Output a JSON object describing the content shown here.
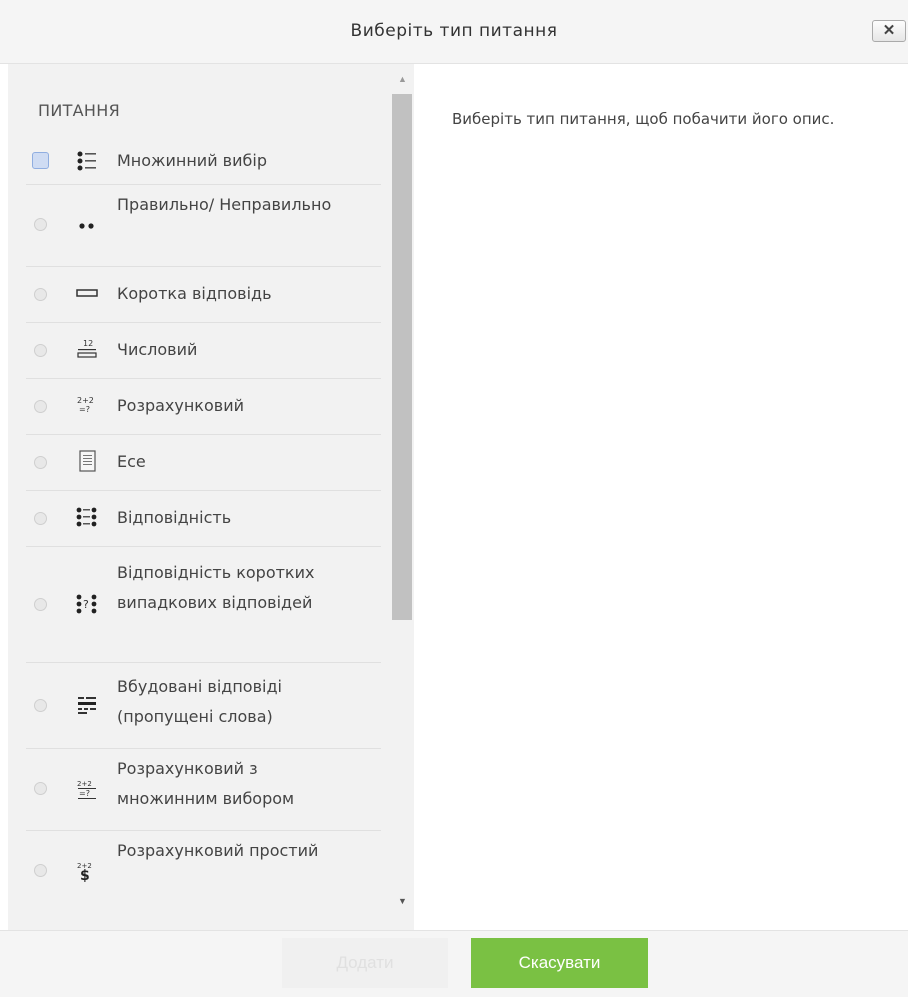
{
  "dialog": {
    "title": "Виберіть тип питання",
    "close_label": "✕"
  },
  "chooser": {
    "section_label": "ПИТАННЯ",
    "items": [
      {
        "label": "Множинний вибір",
        "icon": "multiple-choice-icon",
        "selected": true
      },
      {
        "label": "Правильно/ Неправильно",
        "icon": "true-false-icon",
        "selected": false
      },
      {
        "label": "Коротка відповідь",
        "icon": "short-answer-icon",
        "selected": false
      },
      {
        "label": "Числовий",
        "icon": "numerical-icon",
        "selected": false
      },
      {
        "label": "Розрахунковий",
        "icon": "calculated-icon",
        "selected": false
      },
      {
        "label": "Есе",
        "icon": "essay-icon",
        "selected": false
      },
      {
        "label": "Відповідність",
        "icon": "matching-icon",
        "selected": false
      },
      {
        "label": "Відповідність коротких випадкових відповідей",
        "icon": "random-short-answer-matching-icon",
        "selected": false
      },
      {
        "label": "Вбудовані відповіді (пропущені слова)",
        "icon": "embedded-answers-icon",
        "selected": false
      },
      {
        "label": "Розрахунковий з множинним вибором",
        "icon": "calculated-multichoice-icon",
        "selected": false
      },
      {
        "label": "Розрахунковий простий",
        "icon": "calculated-simple-icon",
        "selected": false
      }
    ]
  },
  "description": {
    "text": "Виберіть тип питання, щоб побачити його опис."
  },
  "footer": {
    "add_label": "Додати",
    "cancel_label": "Скасувати"
  },
  "colors": {
    "cancel_button": "#7ac143",
    "add_button_disabled": "#f0f0f0",
    "options_background": "#f2f2f2",
    "header_background": "#f5f5f5"
  }
}
